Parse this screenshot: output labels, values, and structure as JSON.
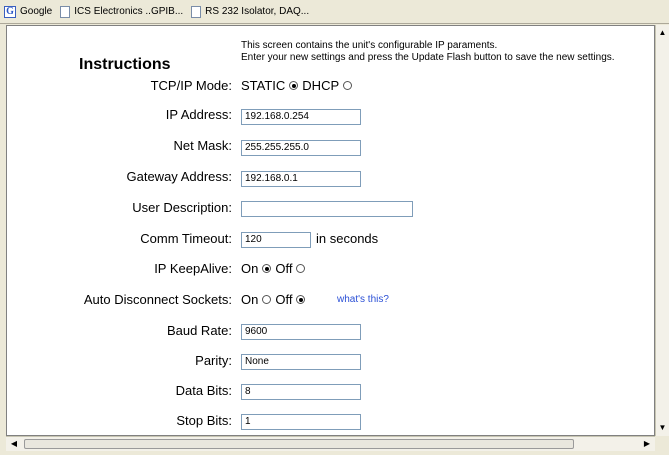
{
  "bookmarks": [
    {
      "label": "Google",
      "icon": "google-icon"
    },
    {
      "label": "ICS Electronics ..GPIB...",
      "icon": "page-icon"
    },
    {
      "label": "RS 232 Isolator, DAQ...",
      "icon": "page-icon"
    }
  ],
  "page": {
    "title": "Instructions",
    "info_line1": "This screen contains the unit's configurable IP paraments.",
    "info_line2": "Enter your new settings and press the Update Flash button to save the new settings.",
    "tcpip": {
      "label": "TCP/IP Mode:",
      "opt1": "STATIC",
      "opt2": "DHCP",
      "selected": "STATIC"
    },
    "ip_address": {
      "label": "IP Address:",
      "value": "192.168.0.254"
    },
    "net_mask": {
      "label": "Net Mask:",
      "value": "255.255.255.0"
    },
    "gateway": {
      "label": "Gateway Address:",
      "value": "192.168.0.1"
    },
    "user_desc": {
      "label": "User Description:",
      "value": ""
    },
    "comm_timeout": {
      "label": "Comm Timeout:",
      "value": "120",
      "unit": "in seconds"
    },
    "keepalive": {
      "label": "IP KeepAlive:",
      "opt1": "On",
      "opt2": "Off",
      "selected": "On"
    },
    "auto_disconnect": {
      "label": "Auto Disconnect Sockets:",
      "opt1": "On",
      "opt2": "Off",
      "selected": "Off",
      "help": "what's this?"
    },
    "baud_rate": {
      "label": "Baud Rate:",
      "value": "9600"
    },
    "parity": {
      "label": "Parity:",
      "value": "None"
    },
    "data_bits": {
      "label": "Data Bits:",
      "value": "8"
    },
    "stop_bits": {
      "label": "Stop Bits:",
      "value": "1"
    }
  }
}
